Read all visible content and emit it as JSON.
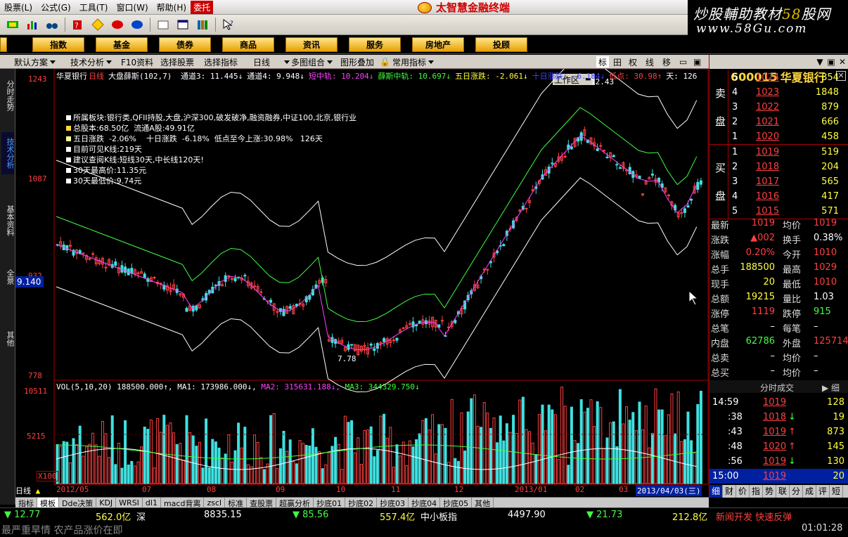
{
  "menu": {
    "items": [
      "股票(L)",
      "公式(G)",
      "工具(T)",
      "窗口(W)",
      "帮助(H)"
    ],
    "hot": "委托"
  },
  "app_title": "太智慧金融终端",
  "watermark": {
    "line1a": "炒股輔助教材",
    "line1b": "58",
    "line1c": "股网",
    "line2": "www.58Gu.com"
  },
  "nav": {
    "items": [
      "指数",
      "基金",
      "债券",
      "商品",
      "资讯",
      "服务",
      "房地产",
      "投顾"
    ],
    "workarea": "工作区"
  },
  "toolbar": {
    "items": [
      "默认方案",
      "技术分析",
      "F10资料",
      "选择股票",
      "选择指标",
      "日线",
      "多图组合",
      "图形叠加",
      "常用指标"
    ],
    "right": [
      "标",
      "田",
      "权",
      "线",
      "移"
    ]
  },
  "sidetabs": [
    "分时走势",
    "技术分析",
    "基本资料",
    "全景",
    "其他"
  ],
  "chart_header": {
    "name": "华夏银行",
    "period": "日线",
    "indicator": "大盘薛斯(102,7)",
    "items": [
      {
        "t": "通道3: 11.445↓",
        "c": "#fff"
      },
      {
        "t": "通道4: 9.948↓",
        "c": "#fff"
      },
      {
        "t": "短中轨: 10.204↓",
        "c": "#ff40ff"
      },
      {
        "t": "薛斯中轨: 10.697↓",
        "c": "#40ff40"
      },
      {
        "t": "五日涨跌: -2.061↓",
        "c": "#ffff40"
      },
      {
        "t": "十日涨跌: -6.184↓",
        "c": "#4040ff"
      },
      {
        "t": "低点: 30.98↑",
        "c": "#ff4040"
      },
      {
        "t": "天: 126",
        "c": "#fff"
      }
    ]
  },
  "info": [
    "所属板块:银行类,QFII持股,大盘,沪深300,破发破净,融资融券,中证100,北京,银行业",
    "总股本:68.50亿  流通A股:49.91亿",
    "五日涨跌  -2.06%    十日涨跌  -6.18%  低点至今上涨:30.98%   126天",
    "目前可见K线:219天",
    "建议查阅K线:短线30天,中长线120天!",
    "30天最高价:11.35元",
    "30天最低价:9.74元"
  ],
  "price_axis": {
    "top": "1243",
    "mid": "1087",
    "low": "932",
    "bottom": "778",
    "box": "9.140",
    "peak": "12.43",
    "trough": "7.78"
  },
  "volume": {
    "header": "VOL(5,10,20)  188500.000↑,",
    "ma1": "MA1: 173986.000↓,",
    "ma2": "MA2: 315631.188↓,",
    "ma3": "MA3: 344329.750↓",
    "axis_top": "10511",
    "axis_mid": "5215",
    "unit": "X100"
  },
  "date_axis": {
    "labels": [
      "2012/05",
      "07",
      "08",
      "09",
      "10",
      "11",
      "12",
      "2013/01",
      "02",
      "03"
    ],
    "current": "2013/04/03(三)",
    "period": "日线"
  },
  "bottom_tabs": [
    "指标",
    "模板",
    "Dde决策",
    "KDJ",
    "WRSI",
    "dl1",
    "macd背离",
    "zscl",
    "标准",
    "查股票",
    "超赢分析",
    "抄底01",
    "抄底02",
    "抄底03",
    "抄底04",
    "抄底05",
    "其他"
  ],
  "quote": {
    "code": "600015",
    "name": "华夏银行",
    "sell": [
      {
        "n": "5",
        "p": "1024",
        "v": "854"
      },
      {
        "n": "4",
        "p": "1023",
        "v": "1848"
      },
      {
        "n": "3",
        "p": "1022",
        "v": "879"
      },
      {
        "n": "2",
        "p": "1021",
        "v": "666"
      },
      {
        "n": "1",
        "p": "1020",
        "v": "458"
      }
    ],
    "buy": [
      {
        "n": "1",
        "p": "1019",
        "v": "519"
      },
      {
        "n": "2",
        "p": "1018",
        "v": "204"
      },
      {
        "n": "3",
        "p": "1017",
        "v": "565"
      },
      {
        "n": "4",
        "p": "1016",
        "v": "417"
      },
      {
        "n": "5",
        "p": "1015",
        "v": "571"
      }
    ],
    "sell_label": [
      "卖",
      "盘"
    ],
    "buy_label": [
      "买",
      "盘"
    ],
    "stats": [
      {
        "l1": "最新",
        "v1": "1019",
        "c1": "red",
        "l2": "均价",
        "v2": "1019",
        "c2": "red"
      },
      {
        "l1": "涨跌",
        "v1": "▲002",
        "c1": "red",
        "l2": "换手",
        "v2": "0.38%",
        "c2": "wht"
      },
      {
        "l1": "涨幅",
        "v1": "0.20%",
        "c1": "red",
        "l2": "今开",
        "v2": "1010",
        "c2": "red"
      },
      {
        "l1": "总手",
        "v1": "188500",
        "c1": "yel",
        "l2": "最高",
        "v2": "1029",
        "c2": "red"
      },
      {
        "l1": "现手",
        "v1": "20",
        "c1": "yel",
        "l2": "最低",
        "v2": "1010",
        "c2": "red"
      },
      {
        "l1": "总额",
        "v1": "19215",
        "c1": "yel",
        "l2": "量比",
        "v2": "1.03",
        "c2": "wht"
      },
      {
        "l1": "涨停",
        "v1": "1119",
        "c1": "red",
        "l2": "跌停",
        "v2": "915",
        "c2": "grn"
      },
      {
        "l1": "总笔",
        "v1": "–",
        "c1": "wht",
        "l2": "每笔",
        "v2": "–",
        "c2": "wht"
      },
      {
        "l1": "内盘",
        "v1": "62786",
        "c1": "grn",
        "l2": "外盘",
        "v2": "125714",
        "c2": "red"
      },
      {
        "l1": "总卖",
        "v1": "–",
        "c1": "wht",
        "l2": "均价",
        "v2": "–",
        "c2": "wht"
      },
      {
        "l1": "总买",
        "v1": "–",
        "c1": "wht",
        "l2": "均价",
        "v2": "–",
        "c2": "wht"
      }
    ],
    "ticks_title": "分时成交",
    "ticks_more": "细",
    "ticks": [
      {
        "t": "14:59",
        "p": "1019",
        "v": "128",
        "a": ""
      },
      {
        "t": ":38",
        "p": "1018",
        "v": "19",
        "a": "↓"
      },
      {
        "t": ":43",
        "p": "1019",
        "v": "873",
        "a": "↑"
      },
      {
        "t": ":48",
        "p": "1020",
        "v": "145",
        "a": "↑"
      },
      {
        "t": ":56",
        "p": "1019",
        "v": "130",
        "a": "↓"
      },
      {
        "t": "15:00",
        "p": "1019",
        "v": "20",
        "a": ""
      }
    ],
    "bottom_tabs": [
      "细",
      "财",
      "价",
      "指",
      "势",
      "联",
      "分",
      "成",
      "评",
      "短"
    ]
  },
  "status": {
    "s1": "▼ 12.77",
    "s2": "562.0亿",
    "s3": "深",
    "s4": "8835.15",
    "s5": "▼ 85.56",
    "s6": "557.4亿",
    "s7": "中小板指",
    "s8": "4497.90",
    "s9": "▼ 21.73",
    "s10": "212.8亿",
    "s11": "新闻开发 快速反弹",
    "time": "01:01:28"
  },
  "news": "最严重旱情 农产品涨价在即"
}
